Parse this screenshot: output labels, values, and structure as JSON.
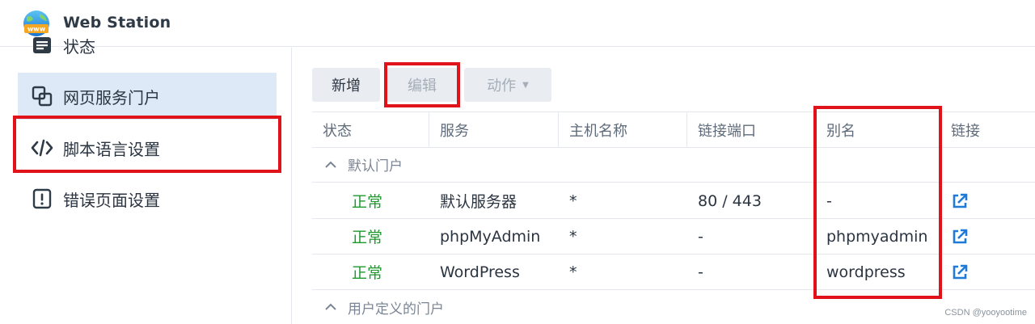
{
  "app": {
    "title": "Web Station",
    "logo_icon": "globe-www-icon"
  },
  "sidebar": {
    "items": [
      {
        "label": "状态",
        "icon": "status-list-icon"
      },
      {
        "label": "网页服务门户",
        "icon": "portal-windows-icon",
        "active": true
      },
      {
        "label": "脚本语言设置",
        "icon": "code-icon"
      },
      {
        "label": "错误页面设置",
        "icon": "error-page-icon"
      }
    ]
  },
  "toolbar": {
    "add_label": "新增",
    "edit_label": "编辑",
    "action_label": "动作"
  },
  "table": {
    "columns": [
      "状态",
      "服务",
      "主机名称",
      "链接端口",
      "别名",
      "链接"
    ],
    "groups": [
      {
        "label": "默认门户",
        "rows": [
          {
            "status": "正常",
            "service": "默认服务器",
            "hostname": "*",
            "port": "80 / 443",
            "alias": "-",
            "link_icon": "external-link-icon"
          },
          {
            "status": "正常",
            "service": "phpMyAdmin",
            "hostname": "*",
            "port": "-",
            "alias": "phpmyadmin",
            "link_icon": "external-link-icon"
          },
          {
            "status": "正常",
            "service": "WordPress",
            "hostname": "*",
            "port": "-",
            "alias": "wordpress",
            "link_icon": "external-link-icon"
          }
        ]
      },
      {
        "label": "用户定义的门户",
        "rows": []
      }
    ]
  },
  "watermark": "CSDN @yooyootime",
  "colors": {
    "highlight": "#e0131a",
    "status_ok": "#1d9a2c",
    "link": "#1f7ad8",
    "active_nav": "#dde9f6"
  }
}
